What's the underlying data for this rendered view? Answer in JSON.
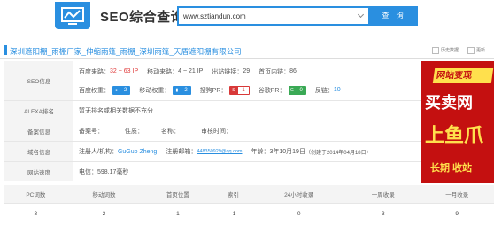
{
  "header": {
    "title": "SEO综合查询",
    "search_value": "www.sztiandun.com",
    "search_button": "查 询"
  },
  "site": {
    "title": "深圳遮阳棚_雨棚厂家_伸缩雨篷_雨棚_深圳雨篷_天盾遮阳棚有限公司",
    "tools": [
      "历史数据",
      "更新"
    ]
  },
  "seo": {
    "label": "SEO信息",
    "baidu_source_label": "百度来路：",
    "baidu_source_value": "32 ~ 63 IP",
    "mobile_source_label": "移动来路：",
    "mobile_source_value": "4 ~ 21 IP",
    "outbound_label": "出站链接：",
    "outbound_value": "29",
    "homepage_links_label": "首页内链：",
    "homepage_links_value": "86",
    "baidu_weight_label": "百度权重：",
    "baidu_weight_value": "2",
    "mobile_weight_label": "移动权重：",
    "mobile_weight_value": "2",
    "sogou_pr_label": "搜狗PR：",
    "sogou_pr_value": "1",
    "google_pr_label": "谷歌PR：",
    "google_pr_value": "0",
    "backlinks_label": "反链：",
    "backlinks_value": "10",
    "colors": {
      "accent": "#2a8fe0",
      "red": "#e03b3b",
      "green": "#3aa955"
    }
  },
  "alexa": {
    "label": "ALEXA排名",
    "text": "暂无排名或相关数据不充分"
  },
  "beian": {
    "label": "备案信息",
    "number": "备案号：",
    "nature": "性质：",
    "name": "名称：",
    "audit_time": "审核时间："
  },
  "domain": {
    "label": "域名信息",
    "registrant_label": "注册人/机构：",
    "registrant_value": "GuGuo Zheng",
    "email_label": "注册邮箱：",
    "email_value": "448350929@qq.com",
    "age_label": "年龄：",
    "age_value": "3年10月19日",
    "created": "（创建于2014年04月18日）"
  },
  "speed": {
    "label": "网站速度",
    "text": "电信：598.17毫秒"
  },
  "ad": {
    "line1": "网站变现",
    "line2": "买卖网",
    "line3": "上鱼爪",
    "line4": "长期  收站"
  },
  "stats": {
    "headers": [
      "PC词数",
      "移动词数",
      "首页位置",
      "索引",
      "24小时收录",
      "一周收录",
      "一月收录"
    ],
    "values": [
      "3",
      "2",
      "1",
      "-1",
      "0",
      "3",
      "9"
    ]
  }
}
